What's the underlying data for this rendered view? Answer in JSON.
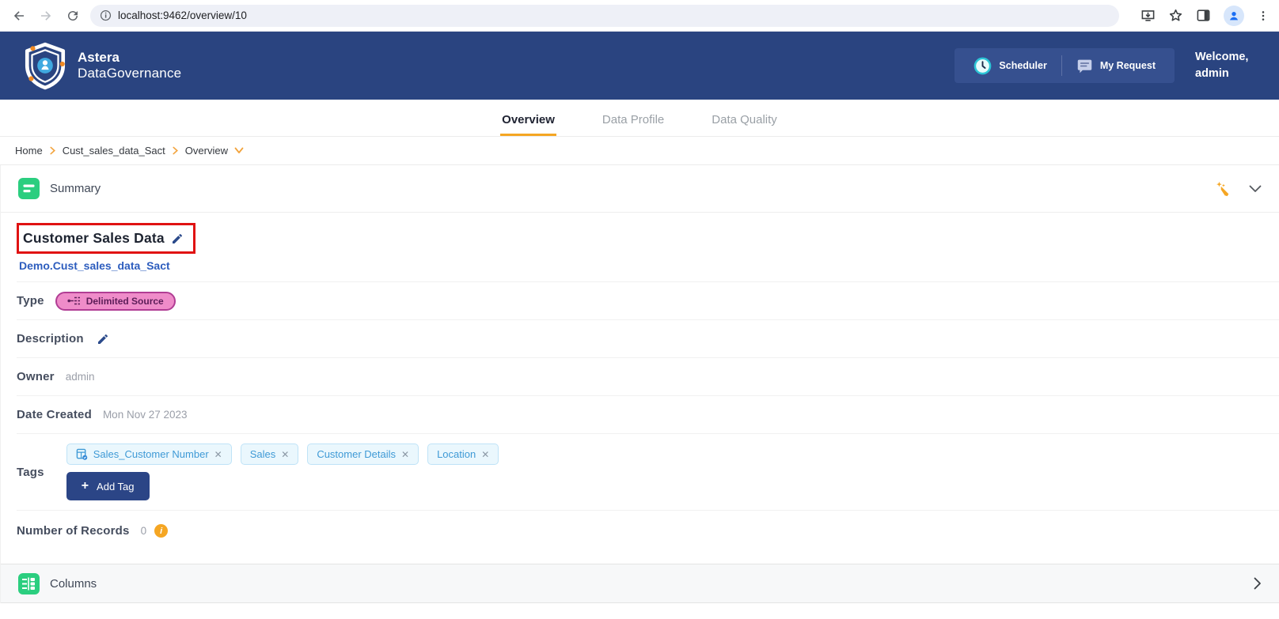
{
  "browser": {
    "url": "localhost:9462/overview/10"
  },
  "header": {
    "brand_line1": "Astera",
    "brand_line2": "DataGovernance",
    "scheduler_label": "Scheduler",
    "my_request_label": "My Request",
    "welcome_line1": "Welcome,",
    "welcome_line2": "admin"
  },
  "tabs": {
    "items": [
      {
        "label": "Overview",
        "active": true
      },
      {
        "label": "Data Profile",
        "active": false
      },
      {
        "label": "Data Quality",
        "active": false
      }
    ]
  },
  "breadcrumb": {
    "items": [
      "Home",
      "Cust_sales_data_Sact",
      "Overview"
    ]
  },
  "summary": {
    "section_title": "Summary",
    "asset_title": "Customer Sales Data",
    "asset_qualified_name": "Demo.Cust_sales_data_Sact",
    "type_label": "Type",
    "type_badge": "Delimited Source",
    "description_label": "Description",
    "owner_label": "Owner",
    "owner_value": "admin",
    "date_created_label": "Date Created",
    "date_created_value": "Mon Nov 27 2023",
    "tags_label": "Tags",
    "tags": {
      "items": [
        {
          "label": "Sales_Customer Number"
        },
        {
          "label": "Sales"
        },
        {
          "label": "Customer Details"
        },
        {
          "label": "Location"
        }
      ],
      "remove_symbol": "✕",
      "add_plus": "+",
      "add_label": "Add Tag"
    },
    "records_label": "Number of Records",
    "records_value": "0",
    "records_info_symbol": "i"
  },
  "columns_section": {
    "title": "Columns"
  },
  "colors": {
    "header_navy": "#2a4480",
    "accent_orange": "#f5a623",
    "icon_green": "#2bce7f",
    "badge_pink_bg": "#ef8cc9",
    "badge_pink_border": "#b13d94",
    "link_blue": "#2d5dbe",
    "chip_blue": "#3f9ad6",
    "annotation_red": "#e01212",
    "add_tag_navy": "#2b4586"
  }
}
